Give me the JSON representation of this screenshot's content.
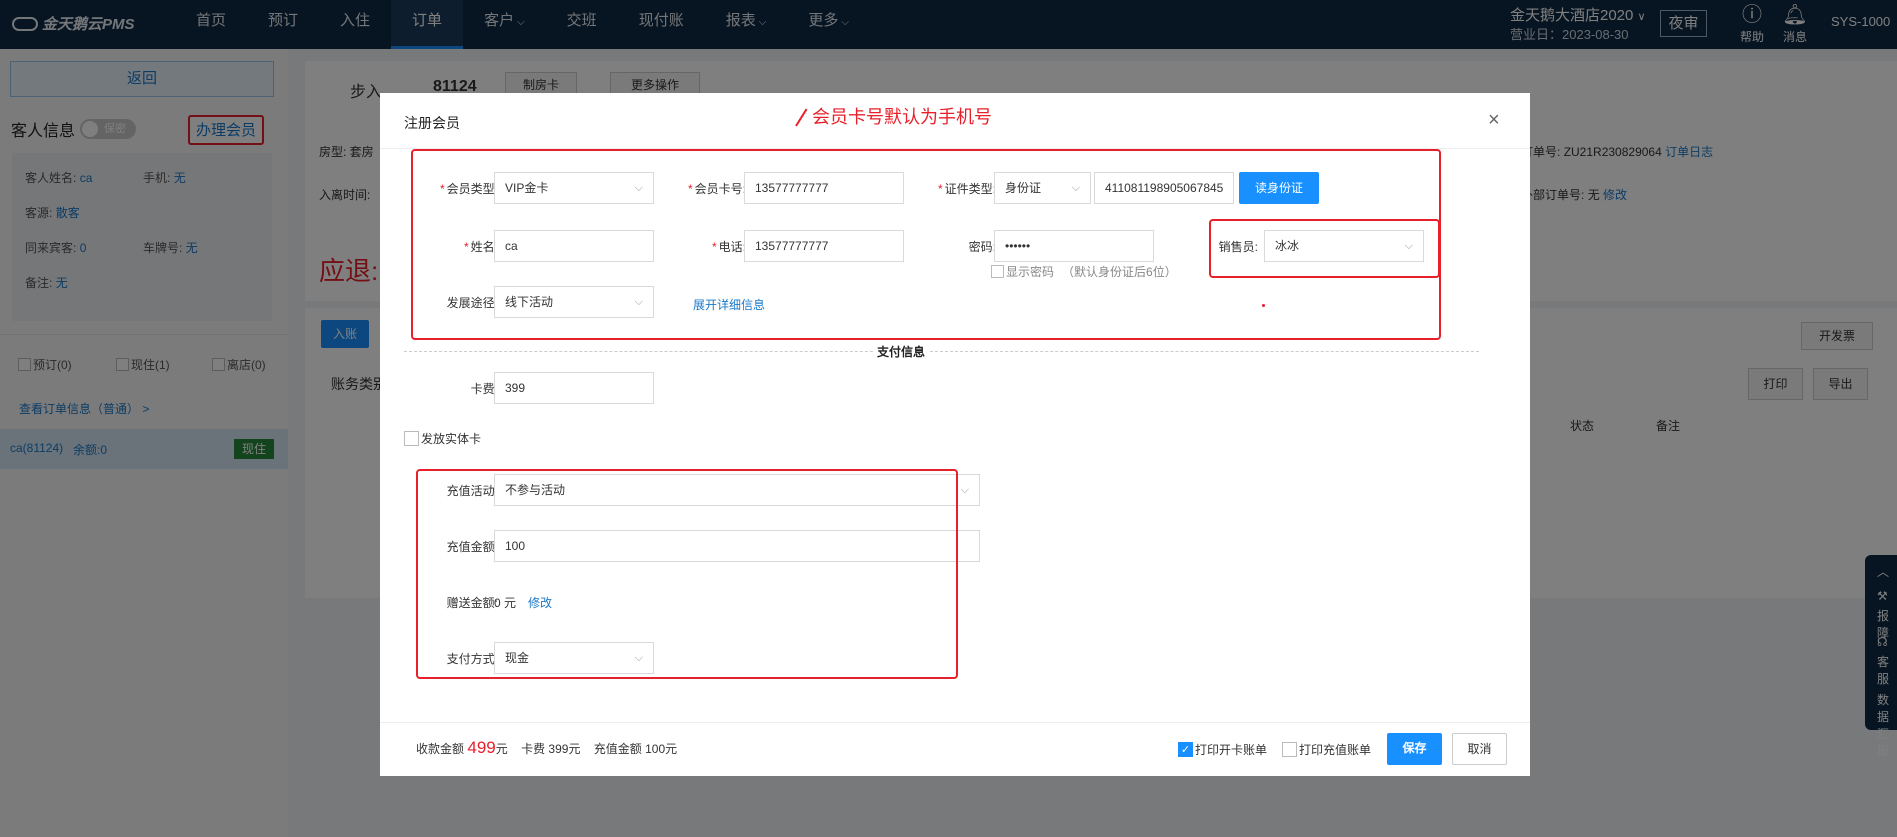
{
  "topbar": {
    "logo": "金天鹅云PMS",
    "nav": [
      "首页",
      "预订",
      "入住",
      "订单",
      "客户",
      "交班",
      "现付账",
      "报表",
      "更多"
    ],
    "hotel": "金天鹅大酒店2020",
    "hotel_chev": "∨",
    "biz_date": "营业日：2023-08-30",
    "night_audit": "夜审",
    "help": "帮助",
    "message": "消息",
    "user": "SYS-1000"
  },
  "left": {
    "back": "返回",
    "guest_info": "客人信息",
    "privacy": "保密",
    "member_btn": "办理会员",
    "name_label": "客人姓名:",
    "name": "ca",
    "phone_label": "手机:",
    "phone": "无",
    "source_label": "客源:",
    "source": "散客",
    "companion_label": "同来宾客:",
    "companion": "0",
    "plate_label": "车牌号:",
    "plate": "无",
    "remark_label": "备注:",
    "remark": "无",
    "filter_reserve": "预订(0)",
    "filter_inhouse": "现住(1)",
    "filter_checkout": "离店(0)",
    "order_link": "查看订单信息（普通）  >",
    "order_name": "ca(81124)",
    "order_balance": "余额:0",
    "order_status": "现住"
  },
  "bg": {
    "step": "步入",
    "order_no": "81124",
    "make_card": "制房卡",
    "more_ops": "更多操作",
    "room_type": "房型:  套房",
    "checkin_time": "入离时间:",
    "order_code_label": "订单号:",
    "order_code": "ZU21R230829064",
    "order_log": "订单日志",
    "ext_order_label": "外部订单号:",
    "ext_order_value": "无",
    "ext_order_edit": "修改",
    "refund": "应退:",
    "post": "入账",
    "invoice": "开发票",
    "account_type": "账务类别",
    "print": "打印",
    "export": "导出",
    "col_status": "状态",
    "col_remark": "备注",
    "side_report": "报障",
    "side_service": "客服",
    "side_data_1": "数据",
    "side_data_2": "汇报"
  },
  "modal": {
    "title": "注册会员",
    "close": "×",
    "member_type_label": "会员类型:",
    "member_type": "VIP金卡",
    "card_no_label": "会员卡号:",
    "card_no": "13577777777",
    "id_type_label": "证件类型:",
    "id_type": "身份证",
    "id_no": "411081198905067845",
    "read_id": "读身份证",
    "name_label": "姓名:",
    "name": "ca",
    "phone_label": "电话:",
    "phone": "13577777777",
    "pwd_label": "密码:",
    "pwd": "••••••",
    "show_pwd": "显示密码",
    "pwd_hint": "（默认身份证后6位）",
    "sales_label": "销售员:",
    "sales": "冰冰",
    "channel_label": "发展途径:",
    "channel": "线下活动",
    "expand": "展开详细信息",
    "pay_info": "支付信息",
    "card_fee_label": "卡费:",
    "card_fee": "399",
    "issue_card": "发放实体卡",
    "recharge_act_label": "充值活动:",
    "recharge_act": "不参与活动",
    "recharge_amt_label": "充值金额:",
    "recharge_amt": "100",
    "gift_label": "赠送金额:",
    "gift_value": "0 元",
    "gift_edit": "修改",
    "pay_method_label": "支付方式:",
    "pay_method": "现金",
    "total_label": "收款金额",
    "total_amt": "499",
    "total_unit": "元",
    "fee_detail": "卡费 399元",
    "recharge_detail": "充值金额 100元",
    "print_open": "打印开卡账单",
    "print_recharge": "打印充值账单",
    "save": "保存",
    "cancel": "取消"
  },
  "annotation": "会员卡号默认为手机号",
  "colors": {
    "nav": "#0f2a44",
    "primary": "#1890ff",
    "annotation": "#e8202a",
    "status": "#27893d"
  }
}
